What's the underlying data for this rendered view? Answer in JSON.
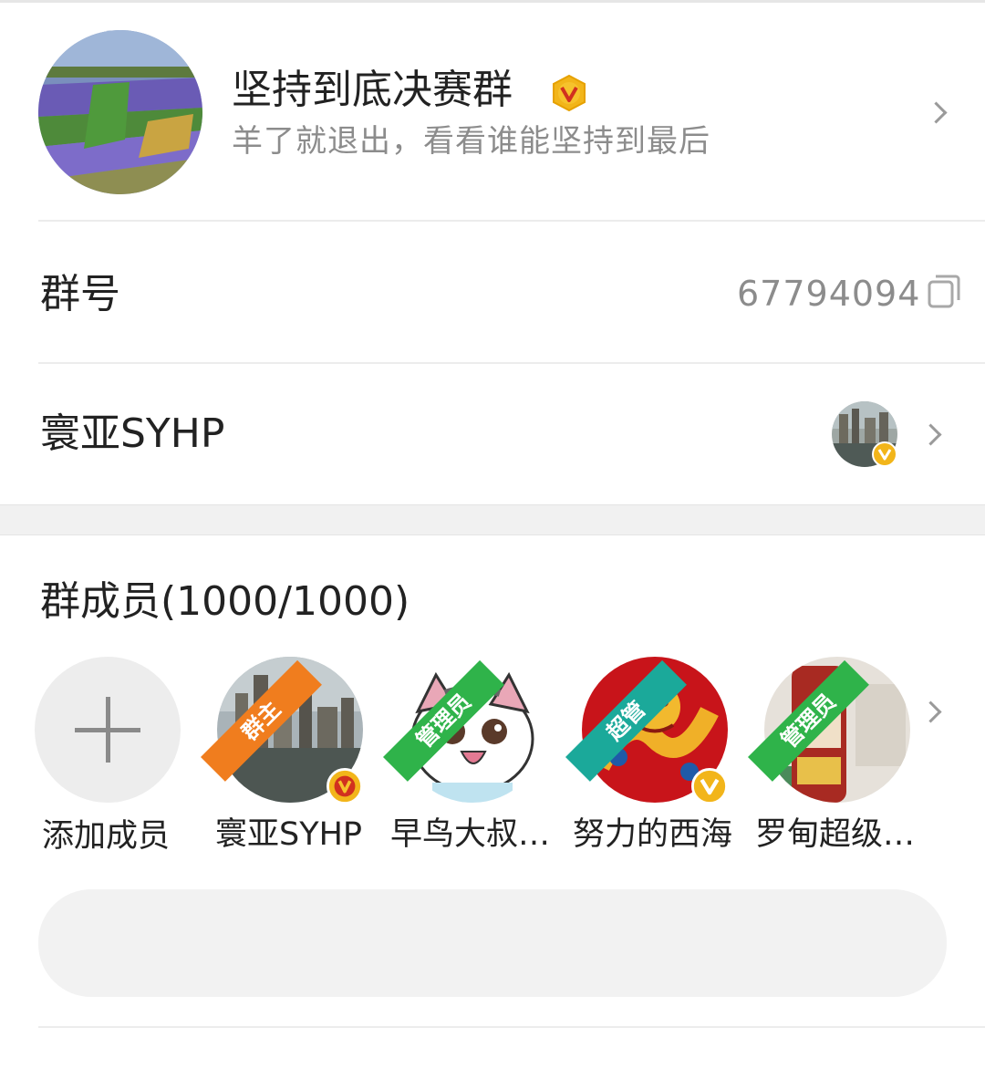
{
  "group": {
    "name": "坚持到底决赛群",
    "description": "羊了就退出，看看谁能坚持到最后",
    "verified_icon": "v-badge-icon"
  },
  "group_number": {
    "label": "群号",
    "value": "67794094",
    "copy_icon": "copy-icon"
  },
  "owner_row": {
    "label": "寰亚SYHP"
  },
  "members": {
    "title": "群成员(1000/1000)",
    "add_label": "添加成员",
    "list": [
      {
        "name": "寰亚SYHP",
        "role": "群主",
        "role_color": "#f07d1e"
      },
      {
        "name": "早鸟大叔…",
        "role": "管理员",
        "role_color": "#2fb34a"
      },
      {
        "name": "努力的西海",
        "role": "超管",
        "role_color": "#1ba99a"
      },
      {
        "name": "罗甸超级…",
        "role": "管理员",
        "role_color": "#2fb34a"
      }
    ]
  },
  "colors": {
    "badge_gold": "#f2b51a",
    "text_secondary": "#8c8c8c"
  }
}
